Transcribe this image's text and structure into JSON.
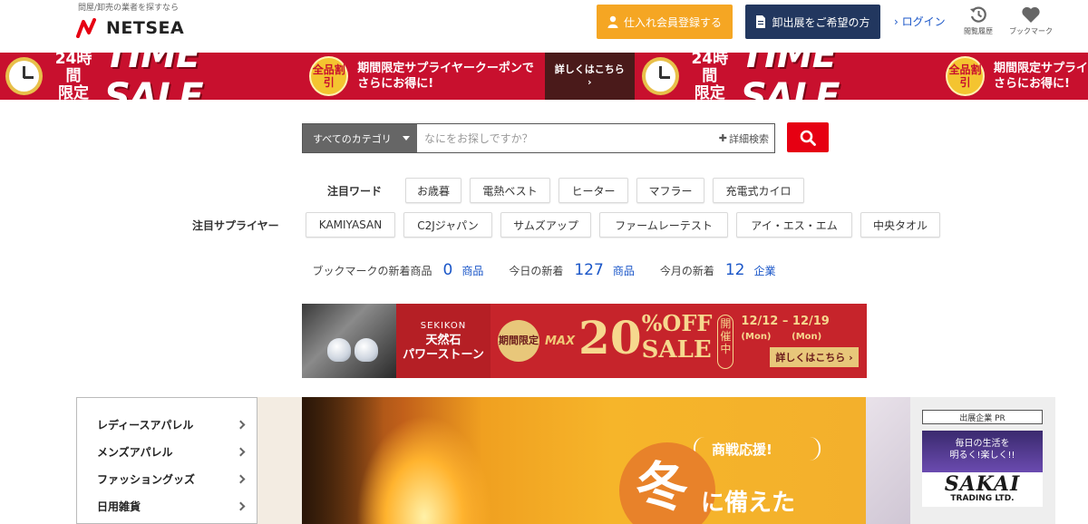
{
  "header": {
    "tagline": "問屋/卸売の業者を探すなら",
    "logo_text": "NETSEA",
    "register_label": "仕入れ会員登録する",
    "exhibit_label": "卸出展をご希望の方",
    "login_label": "ログイン",
    "history_label": "閲覧履歴",
    "bookmark_label": "ブックマーク"
  },
  "sale_banner": {
    "hours_line1": "24時間",
    "hours_line2": "限定",
    "title": "TIME SALE",
    "badge": "全品割引",
    "coupon_line1": "期間限定サプライヤークーポンで",
    "coupon_line2": "さらにお得に!",
    "detail": "詳しくはこちら ›",
    "coupon_line1_b": "期間限定サプライ",
    "coupon_line2_b": "さらにお得に!"
  },
  "search": {
    "category_label": "すべてのカテゴリ",
    "placeholder": "なにをお探しですか？",
    "advanced_label": "詳細検索"
  },
  "keywords": {
    "label": "注目ワード",
    "items": [
      "お歳暮",
      "電熱ベスト",
      "ヒーター",
      "マフラー",
      "充電式カイロ"
    ]
  },
  "suppliers": {
    "label": "注目サプライヤー",
    "items": [
      "KAMIYASAN",
      "C2Jジャパン",
      "サムズアップ",
      "ファームレーテスト",
      "アイ・エス・エム",
      "中央タオル"
    ]
  },
  "counts": {
    "bookmark_label": "ブックマークの新着商品",
    "bookmark_count": "0",
    "bookmark_unit": "商品",
    "today_label": "今日の新着",
    "today_count": "127",
    "today_unit": "商品",
    "month_label": "今月の新着",
    "month_count": "12",
    "month_unit": "企業"
  },
  "promo": {
    "brand": "SEKIKON",
    "brand_line1": "天然石",
    "brand_line2": "パワーストーン",
    "period": "期間限定",
    "max": "MAX",
    "percent": "20",
    "off": "%OFF",
    "sale": "SALE",
    "kaisai": "開催中",
    "date_start": "12/12",
    "date_start_day": "(Mon)",
    "date_sep": "–",
    "date_end": "12/19",
    "date_end_day": "(Mon)",
    "detail": "詳しくはこちら ›"
  },
  "category_menu": {
    "items": [
      "レディースアパレル",
      "メンズアパレル",
      "ファッショングッズ",
      "日用雑貨"
    ]
  },
  "hero": {
    "sub": "商戦応援!",
    "big": "冬",
    "big2": "に備えた"
  },
  "pr": {
    "label": "出展企業 PR",
    "line1": "毎日の生活を",
    "line2": "明るく!楽しく!!",
    "logo": "SAKAI",
    "company": "TRADING LTD."
  },
  "colors": {
    "register": "#f5a623",
    "exhibit": "#22375f",
    "search_button": "#e60012",
    "link": "#1a56c8",
    "sale_banner": "#c8102e"
  }
}
